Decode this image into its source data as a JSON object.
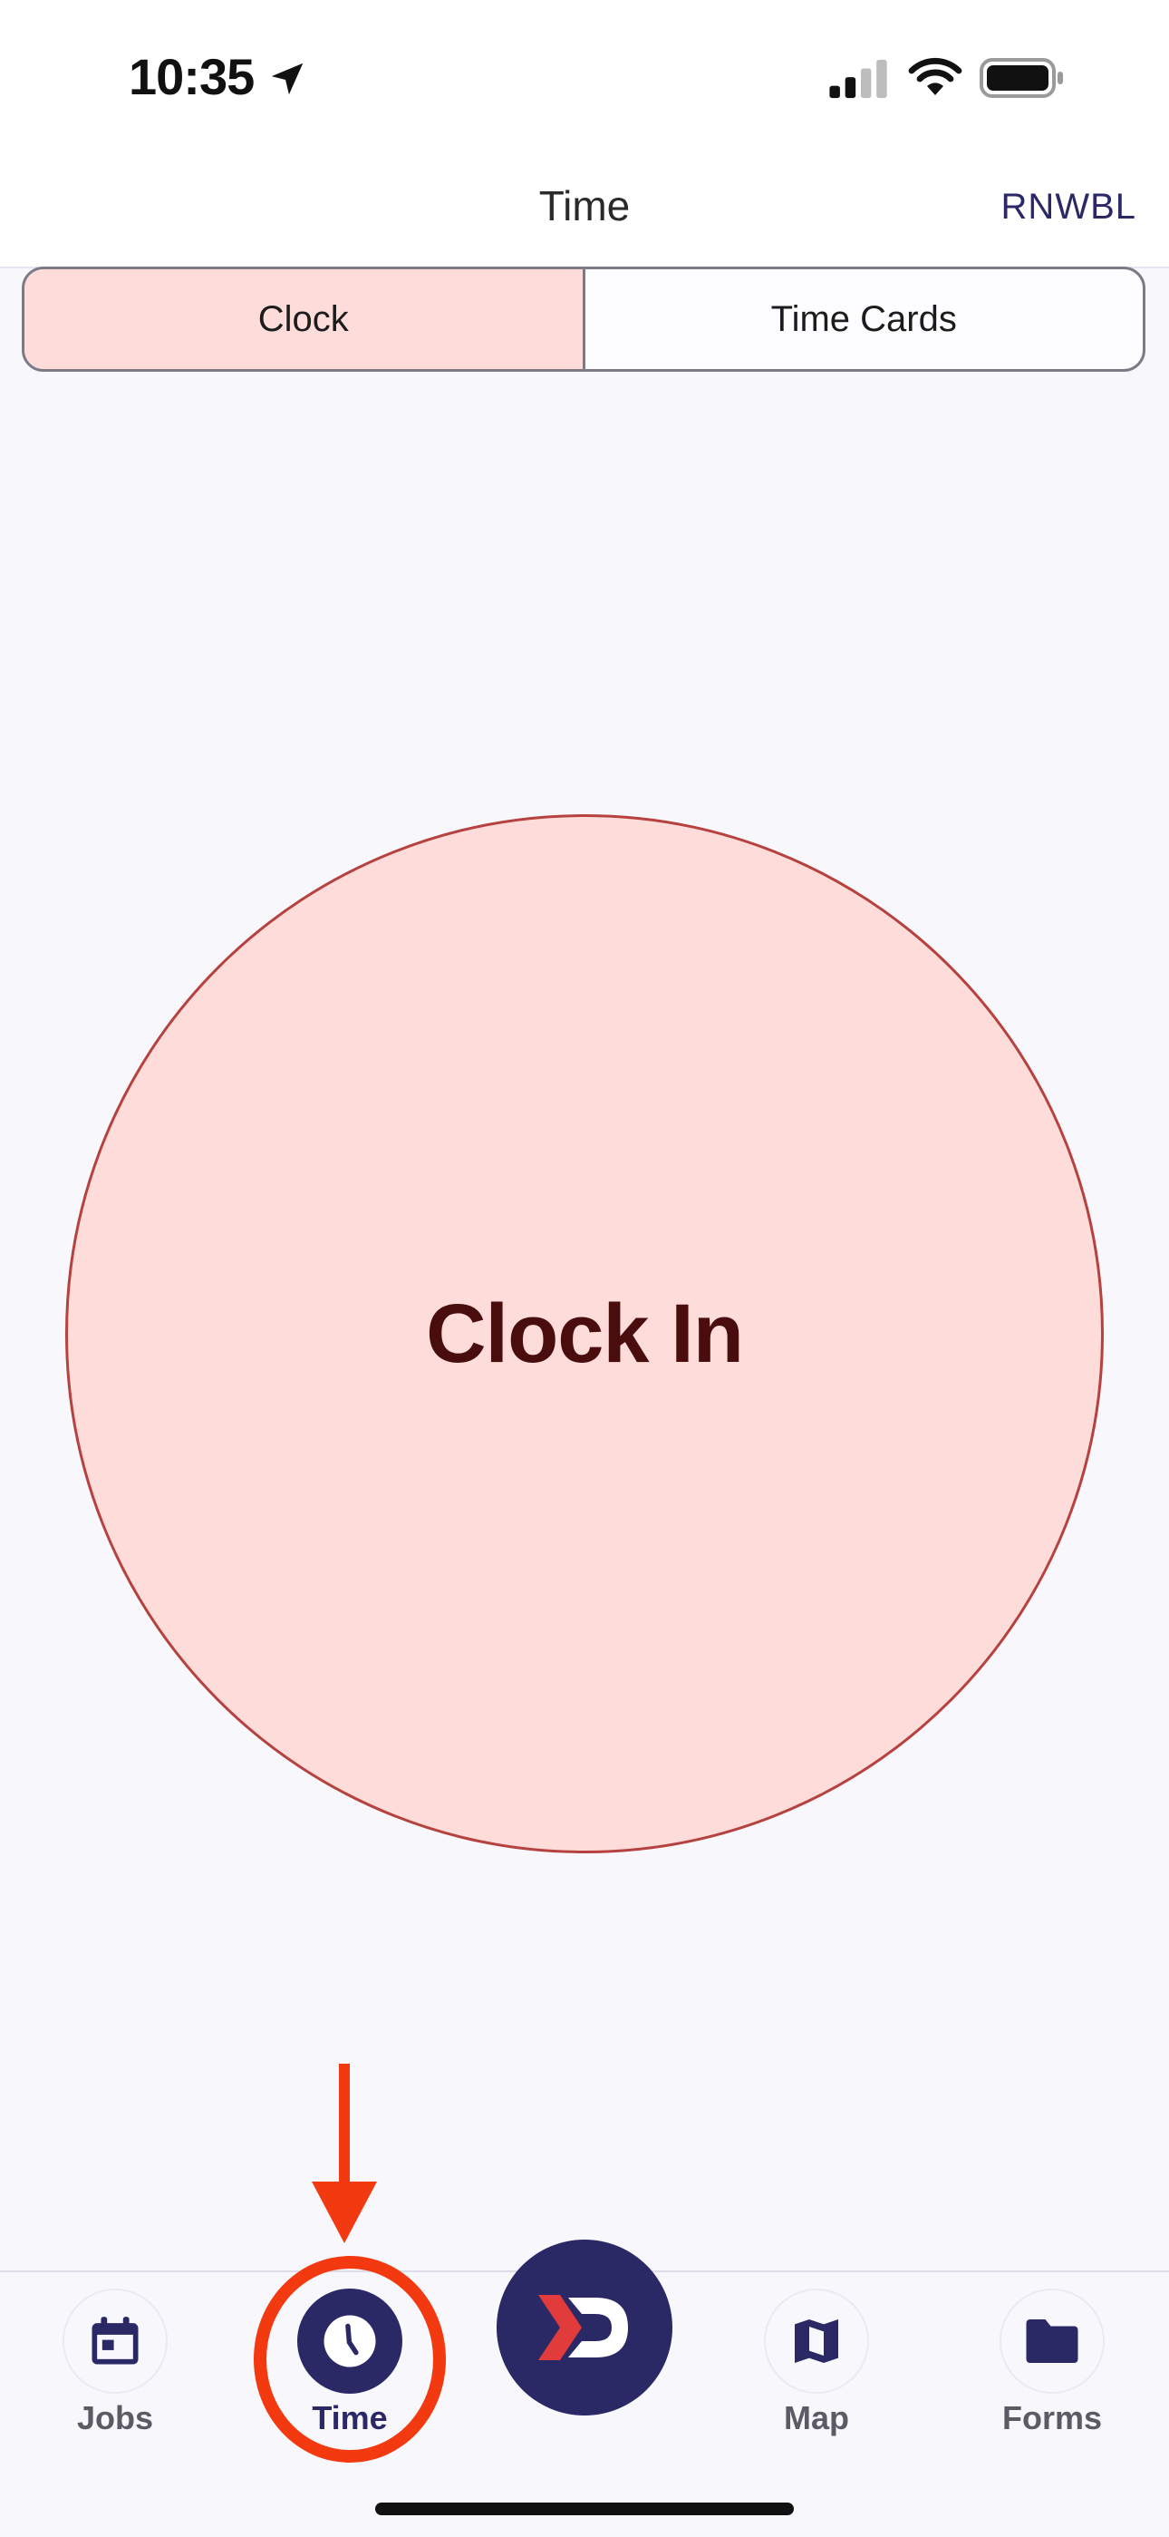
{
  "status_bar": {
    "time": "10:35",
    "icons": [
      "location-arrow-icon",
      "cellular-signal-icon",
      "wifi-icon",
      "battery-icon"
    ]
  },
  "nav": {
    "title": "Time",
    "right_label": "RNWBL"
  },
  "segmented": {
    "tabs": [
      {
        "label": "Clock",
        "selected": true
      },
      {
        "label": "Time Cards",
        "selected": false
      }
    ]
  },
  "main": {
    "clock_button_label": "Clock In"
  },
  "tab_bar": {
    "items": [
      {
        "label": "Jobs",
        "icon": "calendar-icon",
        "active": false
      },
      {
        "label": "Time",
        "icon": "clock-icon",
        "active": true
      },
      {
        "label": "",
        "icon": "app-logo-icon",
        "active": false
      },
      {
        "label": "Map",
        "icon": "map-icon",
        "active": false
      },
      {
        "label": "Forms",
        "icon": "folder-icon",
        "active": false
      }
    ]
  },
  "colors": {
    "brand": "#2b2866",
    "clock_fill": "#fddcda",
    "clock_border": "#b6423f",
    "clock_text": "#4a0d0d",
    "annotation": "#f2390f"
  }
}
